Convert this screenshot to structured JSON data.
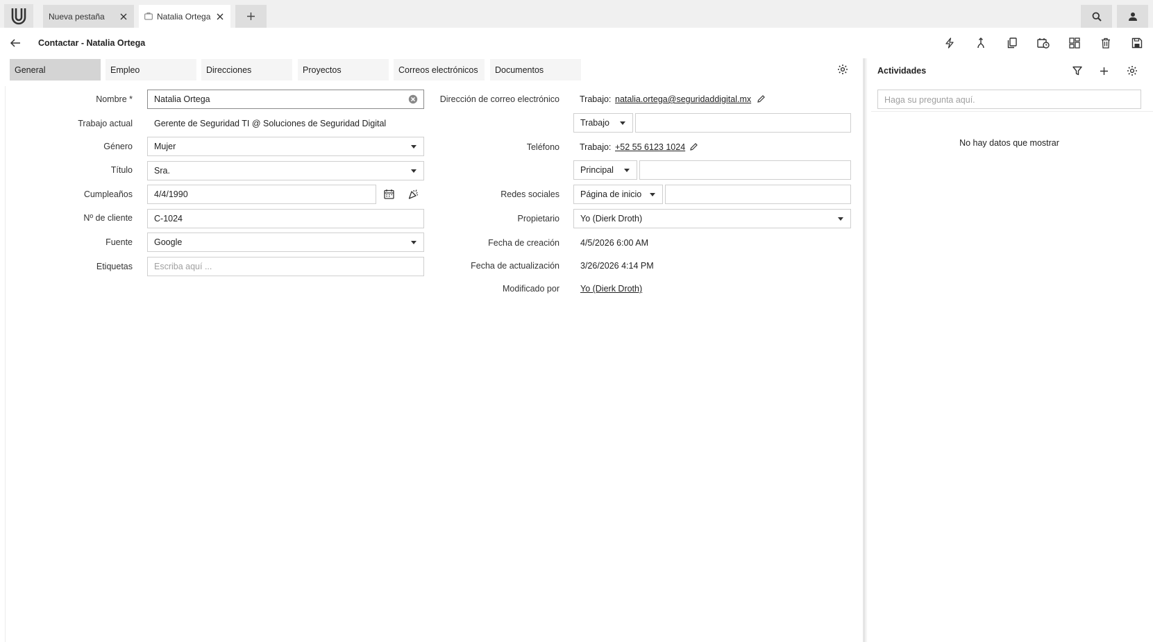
{
  "tabs": [
    {
      "label": "Nueva pestaña"
    },
    {
      "label": "Natalia Ortega"
    }
  ],
  "header": {
    "title": "Contactar - Natalia Ortega",
    "actions": [
      "lightning-icon",
      "merge-icon",
      "copy-icon",
      "calendar-clock-icon",
      "dashboard-icon",
      "trash-icon",
      "save-icon"
    ]
  },
  "form_tabs": [
    "General",
    "Empleo",
    "Direcciones",
    "Proyectos",
    "Correos electrónicos",
    "Documentos"
  ],
  "left": {
    "nombre_label": "Nombre *",
    "nombre_value": "Natalia Ortega",
    "trabajo_label": "Trabajo actual",
    "trabajo_value": "Gerente de Seguridad TI @ Soluciones de Seguridad Digital",
    "genero_label": "Género",
    "genero_value": "Mujer",
    "titulo_label": "Título",
    "titulo_value": "Sra.",
    "cumple_label": "Cumpleaños",
    "cumple_value": "4/4/1990",
    "cliente_label": "Nº de cliente",
    "cliente_value": "C-1024",
    "fuente_label": "Fuente",
    "fuente_value": "Google",
    "etiquetas_label": "Etiquetas",
    "etiquetas_placeholder": "Escriba aquí ..."
  },
  "right": {
    "email_label": "Dirección de correo electrónico",
    "email_prefix": "Trabajo:",
    "email_value": "natalia.ortega@seguridaddigital.mx",
    "email_type": "Trabajo",
    "phone_label": "Teléfono",
    "phone_prefix": "Trabajo:",
    "phone_value": "+52 55 6123 1024",
    "phone_type": "Principal",
    "social_label": "Redes sociales",
    "social_type": "Página de inicio",
    "owner_label": "Propietario",
    "owner_value": "Yo (Dierk Droth)",
    "created_label": "Fecha de creación",
    "created_value": "4/5/2026 6:00 AM",
    "updated_label": "Fecha de actualización",
    "updated_value": "3/26/2026 4:14 PM",
    "modified_label": "Modificado por",
    "modified_value": "Yo (Dierk Droth)"
  },
  "activities": {
    "title": "Actividades",
    "search_placeholder": "Haga su pregunta aquí.",
    "empty_text": "No hay datos que mostrar"
  }
}
